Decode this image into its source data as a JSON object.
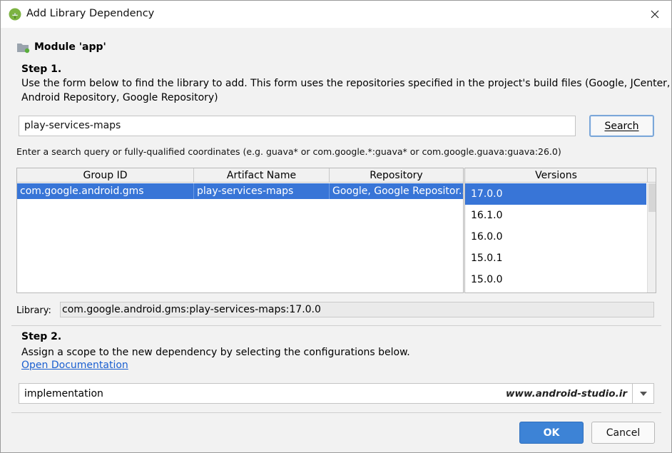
{
  "window": {
    "title": "Add Library Dependency"
  },
  "module": {
    "label": "Module 'app'"
  },
  "step1": {
    "title": "Step 1.",
    "line1": "Use the form below to find the library to add. This form uses the repositories specified in the project's build files (Google, JCenter,",
    "line2": "Android Repository, Google Repository)"
  },
  "search": {
    "value": "play-services-maps",
    "button_label": "Search",
    "hint": "Enter a search query or fully-qualified coordinates (e.g. guava* or com.google.*:guava* or com.google.guava:guava:26.0)"
  },
  "results_table": {
    "columns": [
      "Group ID",
      "Artifact Name",
      "Repository"
    ],
    "rows": [
      [
        "com.google.android.gms",
        "play-services-maps",
        "Google, Google Repositor..."
      ]
    ]
  },
  "versions": {
    "header": "Versions",
    "items": [
      "17.0.0",
      "16.1.0",
      "16.0.0",
      "15.0.1",
      "15.0.0"
    ],
    "selected": "17.0.0"
  },
  "library": {
    "label": "Library:",
    "value": "com.google.android.gms:play-services-maps:17.0.0"
  },
  "step2": {
    "title": "Step 2.",
    "text": "Assign a scope to the new dependency by selecting the configurations below.",
    "link": "Open Documentation"
  },
  "scope": {
    "value": "implementation",
    "watermark": "www.android-studio.ir"
  },
  "buttons": {
    "ok": "OK",
    "cancel": "Cancel"
  },
  "colors": {
    "selection": "#3875d7",
    "primary_button": "#3d83d6",
    "link": "#1a5fd0",
    "android_green": "#7cb342"
  }
}
